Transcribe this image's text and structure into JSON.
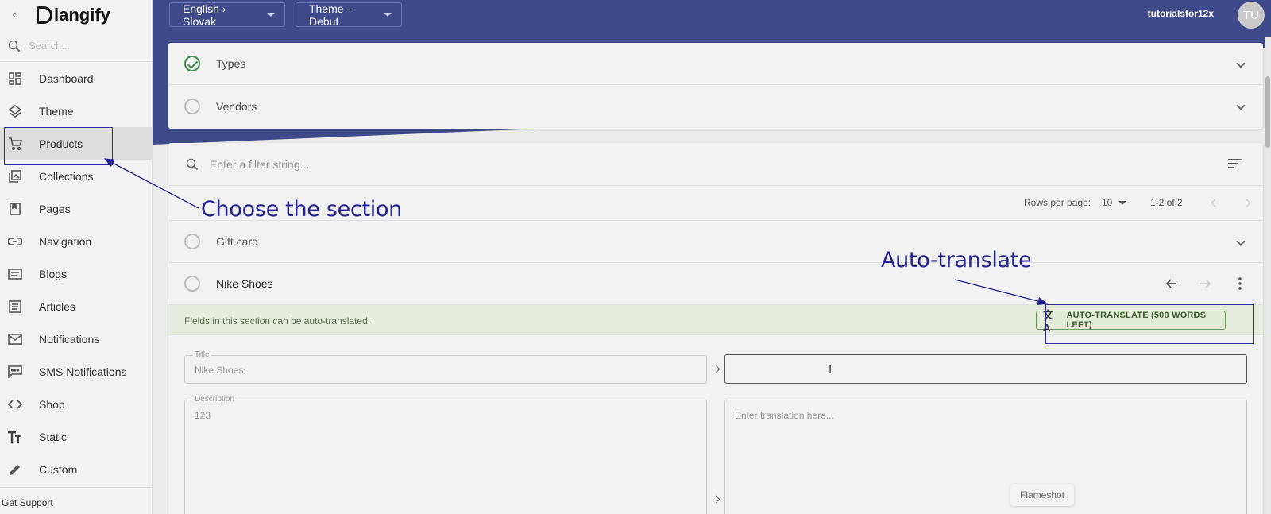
{
  "sidebar": {
    "logo_text": "langify",
    "search_placeholder": "Search...",
    "items": [
      {
        "label": "Dashboard",
        "icon": "dashboard-icon"
      },
      {
        "label": "Theme",
        "icon": "layers-icon"
      },
      {
        "label": "Products",
        "icon": "cart-icon",
        "active": true
      },
      {
        "label": "Collections",
        "icon": "collections-icon"
      },
      {
        "label": "Pages",
        "icon": "page-icon"
      },
      {
        "label": "Navigation",
        "icon": "link-icon"
      },
      {
        "label": "Blogs",
        "icon": "blog-icon"
      },
      {
        "label": "Articles",
        "icon": "article-icon"
      },
      {
        "label": "Notifications",
        "icon": "mail-icon"
      },
      {
        "label": "SMS Notifications",
        "icon": "sms-icon"
      },
      {
        "label": "Shop",
        "icon": "code-icon"
      },
      {
        "label": "Static",
        "icon": "text-icon"
      },
      {
        "label": "Custom",
        "icon": "pencil-icon"
      }
    ],
    "support_label": "Get Support"
  },
  "header": {
    "language_label": "English › Slovak",
    "theme_label": "Theme - Debut",
    "username": "tutorialsfor12x",
    "avatar_initials": "TU",
    "bg_color": "#3f4a8a"
  },
  "categories": {
    "types_label": "Types",
    "vendors_label": "Vendors"
  },
  "filter": {
    "placeholder": "Enter a filter string...",
    "rows_per_page_label": "Rows per page:",
    "rows_per_page_value": "10",
    "range_label": "1-2 of 2"
  },
  "items": {
    "gift_card_label": "Gift card",
    "nike_label": "Nike Shoes"
  },
  "autotranslate": {
    "message": "Fields in this section can be auto-translated.",
    "button_label": "AUTO-TRANSLATE (500 WORDS LEFT)"
  },
  "fields": {
    "title_label": "Title",
    "title_value": "Nike Shoes",
    "description_label": "Description",
    "description_value": "123",
    "translation_placeholder": "Enter translation here..."
  },
  "annotations": {
    "choose_section": "Choose the section",
    "auto_translate": "Auto-translate",
    "color": "#23238f"
  },
  "overlay": {
    "flameshot_label": "Flameshot"
  }
}
